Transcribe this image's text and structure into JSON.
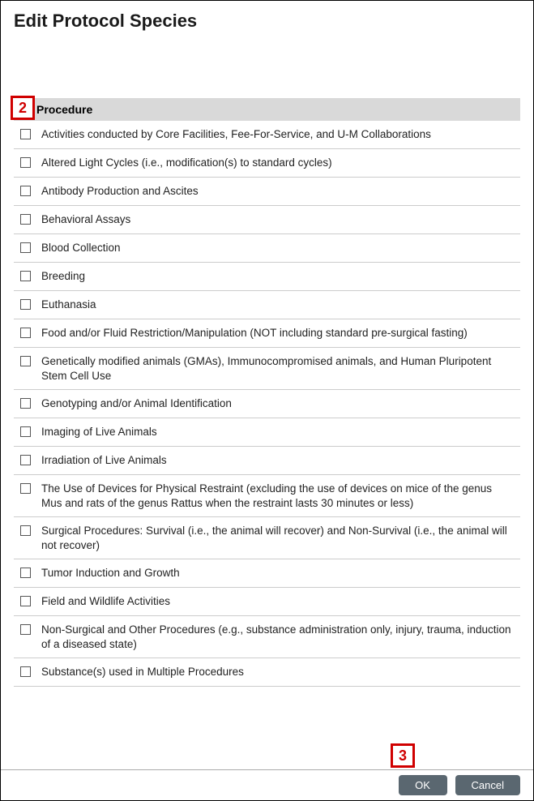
{
  "title": "Edit Protocol Species",
  "header": "Procedure",
  "callouts": {
    "two": "2",
    "three": "3"
  },
  "procedures": [
    {
      "label": "Activities conducted by Core Facilities, Fee-For-Service, and U-M Collaborations"
    },
    {
      "label": "Altered Light Cycles (i.e., modification(s) to standard cycles)"
    },
    {
      "label": "Antibody Production and Ascites"
    },
    {
      "label": "Behavioral Assays"
    },
    {
      "label": "Blood Collection"
    },
    {
      "label": "Breeding"
    },
    {
      "label": "Euthanasia"
    },
    {
      "label": "Food and/or Fluid Restriction/Manipulation (NOT including standard pre-surgical fasting)"
    },
    {
      "label": "Genetically modified animals (GMAs), Immunocompromised animals, and Human Pluripotent Stem Cell Use"
    },
    {
      "label": "Genotyping and/or Animal Identification"
    },
    {
      "label": "Imaging of Live Animals"
    },
    {
      "label": "Irradiation of Live Animals"
    },
    {
      "label": "The Use of Devices for Physical Restraint (excluding the use of devices on mice of the genus Mus and rats of the genus Rattus when the restraint lasts 30 minutes or less)"
    },
    {
      "label": "Surgical Procedures: Survival (i.e., the animal will recover) and Non-Survival (i.e., the animal will not recover)"
    },
    {
      "label": "Tumor Induction and Growth"
    },
    {
      "label": "Field and Wildlife Activities"
    },
    {
      "label": "Non-Surgical and Other Procedures (e.g., substance administration only, injury, trauma, induction of a diseased state)"
    },
    {
      "label": "Substance(s) used in Multiple Procedures"
    }
  ],
  "buttons": {
    "ok": "OK",
    "cancel": "Cancel"
  }
}
